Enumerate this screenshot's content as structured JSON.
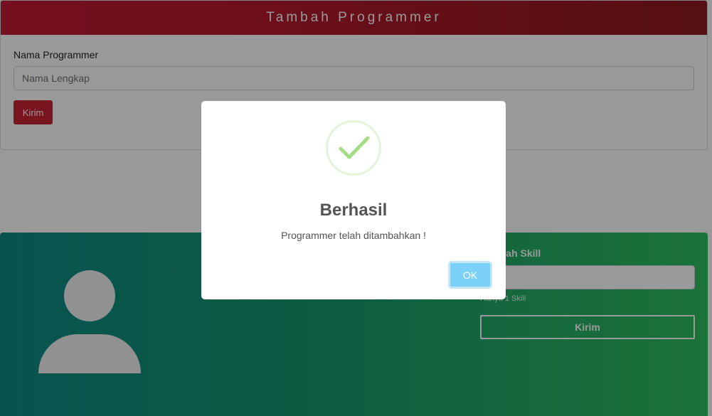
{
  "form": {
    "title": "Tambah Programmer",
    "name_label": "Nama Programmer",
    "name_placeholder": "Nama Lengkap",
    "submit_label": "Kirim"
  },
  "skill": {
    "label": "Tambah Skill",
    "input_value": "",
    "help_text": "Hanya 1 Skill",
    "submit_label": "Kirim",
    "avatar_icon": "user-avatar-icon"
  },
  "modal": {
    "icon": "success-checkmark-icon",
    "title": "Berhasil",
    "message": "Programmer telah ditambahkan !",
    "ok_label": "OK"
  },
  "colors": {
    "header_red": "#c51a34",
    "button_red": "#c82434",
    "green_start": "#0e8a86",
    "green_end": "#2fc05f",
    "ok_button": "#7cd1f9",
    "success_check": "#a5dc86"
  }
}
